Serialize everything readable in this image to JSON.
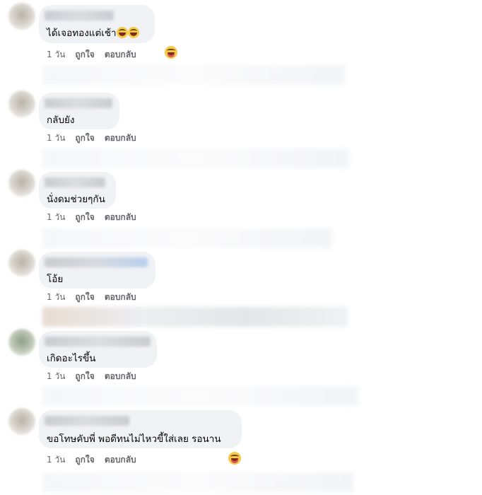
{
  "comments": [
    {
      "text": "ได้เจอทองแต่เช้า",
      "time": "1 วัน",
      "like": "ถูกใจ",
      "reply": "ตอบกลับ"
    },
    {
      "text": "กลับยัง",
      "time": "1 วัน",
      "like": "ถูกใจ",
      "reply": "ตอบกลับ"
    },
    {
      "text": "นั่งดมช่วยๆกัน",
      "time": "1 วัน",
      "like": "ถูกใจ",
      "reply": "ตอบกลับ"
    },
    {
      "text": "โอ้ย",
      "time": "1 วัน",
      "like": "ถูกใจ",
      "reply": "ตอบกลับ"
    },
    {
      "text": "เกิดอะไรขึ้น",
      "time": "1 วัน",
      "like": "ถูกใจ",
      "reply": "ตอบกลับ"
    },
    {
      "text": "ขอโทษคับพี่ พอดีทนไม่ไหวขี้ใส่เลย รอนาน",
      "time": "1 วัน",
      "like": "ถูกใจ",
      "reply": "ตอบกลับ"
    }
  ],
  "colors": {
    "bubble": "#f0f2f5",
    "meta_text": "#65676b",
    "body_text": "#050505"
  },
  "icons": [
    "grinning-face-icon",
    "face-with-tongue-icon"
  ]
}
